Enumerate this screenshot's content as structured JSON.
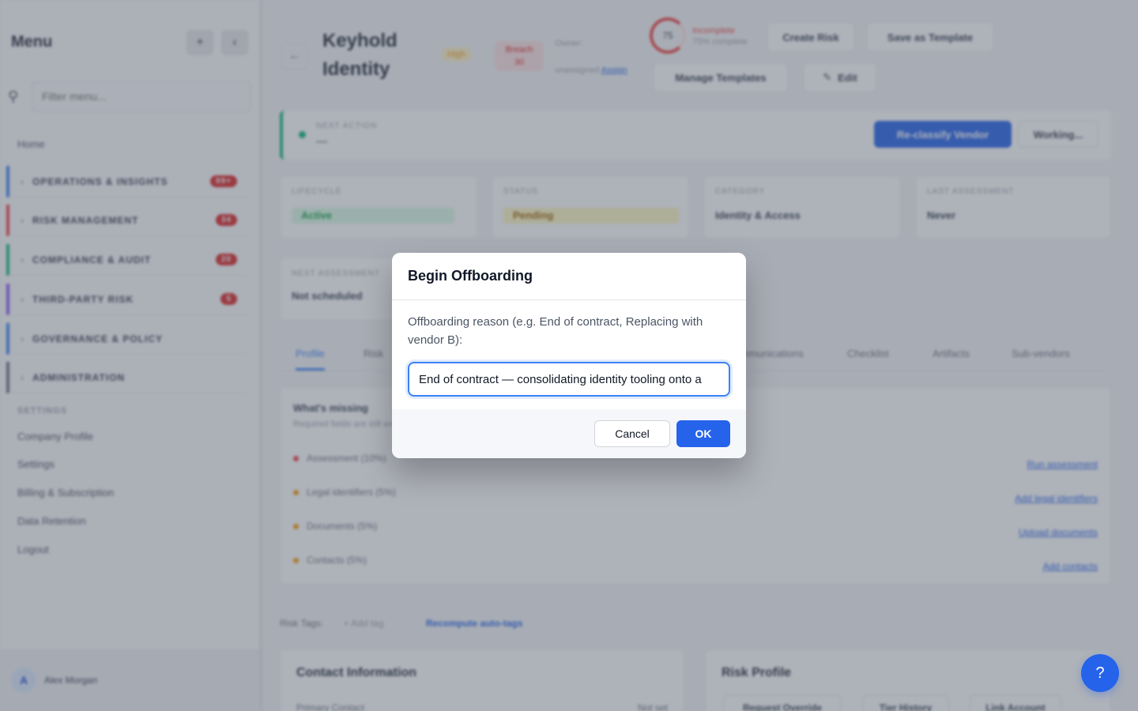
{
  "sidebar": {
    "title": "Menu",
    "add_icon": "+",
    "collapse_icon": "‹",
    "search_placeholder": "Filter menu...",
    "home": "Home",
    "groups": [
      {
        "label": "OPERATIONS & INSIGHTS",
        "badge": "99+",
        "color": "#3b82f6"
      },
      {
        "label": "RISK MANAGEMENT",
        "badge": "34",
        "color": "#ef4444"
      },
      {
        "label": "COMPLIANCE & AUDIT",
        "badge": "20",
        "color": "#10b981"
      },
      {
        "label": "THIRD-PARTY RISK",
        "badge": "5",
        "color": "#8b5cf6"
      },
      {
        "label": "GOVERNANCE & POLICY",
        "badge": "",
        "color": "#3b82f6"
      },
      {
        "label": "ADMINISTRATION",
        "badge": "",
        "color": "#6b7280"
      }
    ],
    "settings_section": "SETTINGS",
    "settings_links": [
      "Company Profile",
      "Settings",
      "Billing & Subscription",
      "Data Retention",
      "Logout"
    ],
    "user": {
      "initial": "A",
      "name": "Alex Morgan"
    }
  },
  "header": {
    "vendor_name": "Keyhold Identity",
    "severity": "High",
    "status_badge": "Breach 30",
    "owner_label": "Owner:",
    "owner_value": "unassigned",
    "owner_link": "Assign",
    "completeness_value": "75",
    "completeness_label": "Incomplete",
    "completeness_sub": "75% complete",
    "buttons": {
      "create_risk": "Create Risk",
      "save_template": "Save as Template",
      "manage_templates": "Manage Templates",
      "edit": "Edit"
    }
  },
  "next_action": {
    "label": "NEXT ACTION",
    "value": "—",
    "reclassify": "Re-classify Vendor",
    "working": "Working..."
  },
  "stats": [
    {
      "label": "LIFECYCLE",
      "value": "Active",
      "color": "#dcfce7"
    },
    {
      "label": "STATUS",
      "value": "Pending",
      "color": "#fef9c3"
    },
    {
      "label": "CATEGORY",
      "value": "Identity & Access",
      "color": ""
    },
    {
      "label": "LAST ASSESSMENT",
      "value": "Never",
      "color": ""
    }
  ],
  "next_assessment": {
    "label": "NEXT ASSESSMENT",
    "value": "Not scheduled"
  },
  "tabs": [
    "Profile",
    "Risk",
    "Communications",
    "Checklist",
    "Artifacts",
    "Sub-vendors"
  ],
  "missing": {
    "title": "What's missing",
    "subtitle": "Required fields are still empty",
    "items": [
      {
        "label": "Assessment (10%)",
        "link": "Run assessment",
        "color": "#ef4444"
      },
      {
        "label": "Legal identifiers (5%)",
        "link": "Add legal identifiers",
        "color": "#f59e0b"
      },
      {
        "label": "Documents (5%)",
        "link": "Upload documents",
        "color": "#f59e0b"
      },
      {
        "label": "Contacts (5%)",
        "link": "Add contacts",
        "color": "#f59e0b"
      }
    ]
  },
  "tags": {
    "label": "Risk Tags:",
    "add": "+ Add tag",
    "recompute": "Recompute auto-tags"
  },
  "contact_card": {
    "title": "Contact Information",
    "row_label": "Primary Contact",
    "row_value": "Not set"
  },
  "risk_card": {
    "title": "Risk Profile",
    "buttons": [
      "Request Override",
      "Tier History",
      "Link Account"
    ]
  },
  "help_icon": "?",
  "modal": {
    "title": "Begin Offboarding",
    "label": "Offboarding reason (e.g. End of contract, Replacing with vendor B):",
    "input_value": "End of contract — consolidating identity tooling onto a",
    "cancel": "Cancel",
    "ok": "OK"
  }
}
